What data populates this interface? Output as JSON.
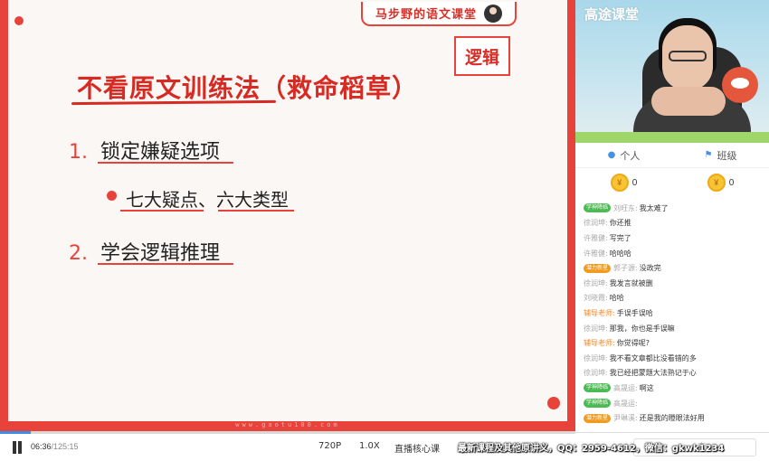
{
  "slide": {
    "brand": "马步野的语文课堂",
    "logic_tag": "逻辑",
    "title": "不看原文训练法（救命稻草）",
    "items": [
      {
        "num": "1.",
        "label": "锁定嫌疑选项"
      },
      {
        "num": "2.",
        "label": "学会逻辑推理"
      }
    ],
    "sub_item_a": "七大疑点",
    "sub_item_sep": "、",
    "sub_item_b": "六大类型",
    "footer_url": "www.gaotu100.com"
  },
  "side": {
    "logo": "高途课堂",
    "tabs": [
      {
        "icon": "person-icon",
        "label": "个人"
      },
      {
        "icon": "flag-icon",
        "label": "班级"
      }
    ],
    "coins": [
      "0",
      "0"
    ],
    "chat": [
      {
        "badge": "学神降临",
        "badge_color": "green",
        "name": "刘旺东:",
        "text": "我太难了"
      },
      {
        "badge": "",
        "name": "徐润坤:",
        "text": "你还推"
      },
      {
        "badge": "",
        "name": "许雅健:",
        "text": "写完了"
      },
      {
        "badge": "",
        "name": "许雅健:",
        "text": "哈哈哈"
      },
      {
        "badge": "潜力新星",
        "badge_color": "orange",
        "name": "郭子源:",
        "text": "没政完"
      },
      {
        "badge": "",
        "name": "徐润坤:",
        "text": "我发言就被删"
      },
      {
        "badge": "",
        "name": "刘晓霞:",
        "text": "哈哈"
      },
      {
        "badge": "",
        "name": "辅导老师:",
        "teacher": true,
        "text": "手误手误哈"
      },
      {
        "badge": "",
        "name": "徐润坤:",
        "text": "那我，你也是手误嘛"
      },
      {
        "badge": "",
        "name": "辅导老师:",
        "teacher": true,
        "text": "你觉得呢?"
      },
      {
        "badge": "",
        "name": "徐润坤:",
        "text": "我不看文章都比没看错的多"
      },
      {
        "badge": "",
        "name": "徐润坤:",
        "text": "我已经把蒙题大法熟记于心"
      },
      {
        "badge": "学神降临",
        "badge_color": "green",
        "name": "高晟运:",
        "text": "啊这"
      },
      {
        "badge": "学神降临",
        "badge_color": "green",
        "name": "高晟运:",
        "text": ""
      },
      {
        "badge": "潜力新星",
        "badge_color": "orange",
        "name": "尹琳溪:",
        "text": "还是我的瞪眼法好用"
      }
    ]
  },
  "player": {
    "current_time": "06:36",
    "total_time": "/125:15",
    "progress": 0.053,
    "quality": "720P",
    "speed": "1.0X",
    "mode": "直播核心课",
    "ticker": "最新课程及其他原讲义，QQ：2959-4612，微信：gkwk1234",
    "input_hint": "言"
  },
  "colors": {
    "accent": "#e8433b",
    "link_blue": "#3a8ee6"
  }
}
